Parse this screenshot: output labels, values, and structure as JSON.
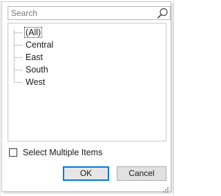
{
  "search": {
    "placeholder": "Search",
    "value": "",
    "icon": "search-icon"
  },
  "tree": {
    "items": [
      {
        "label": "(All)",
        "focused": true
      },
      {
        "label": "Central"
      },
      {
        "label": "East"
      },
      {
        "label": "South"
      },
      {
        "label": "West"
      }
    ]
  },
  "multi_select": {
    "label": "Select Multiple Items",
    "checked": false
  },
  "buttons": {
    "ok_label": "OK",
    "cancel_label": "Cancel"
  },
  "colors": {
    "focus_border": "#0078d7",
    "panel_border": "#c6c6c6"
  }
}
